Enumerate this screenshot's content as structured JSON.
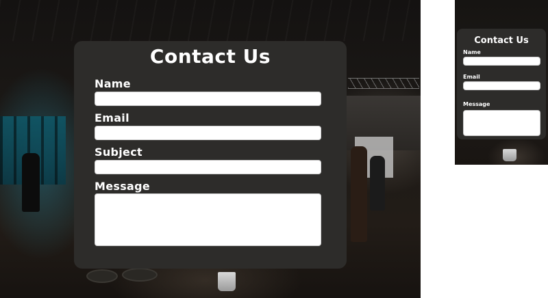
{
  "desktop": {
    "title": "Contact Us",
    "fields": {
      "name": {
        "label": "Name",
        "value": ""
      },
      "email": {
        "label": "Email",
        "value": ""
      },
      "subject": {
        "label": "Subject",
        "value": ""
      },
      "message": {
        "label": "Message",
        "value": ""
      }
    }
  },
  "mobile": {
    "title": "Contact Us",
    "fields": {
      "name": {
        "label": "Name",
        "value": ""
      },
      "email": {
        "label": "Email",
        "value": ""
      },
      "message": {
        "label": "Message",
        "value": ""
      }
    }
  },
  "colors": {
    "card_background": "#2d2c2a",
    "text": "#ffffff",
    "input_background": "#ffffff"
  }
}
